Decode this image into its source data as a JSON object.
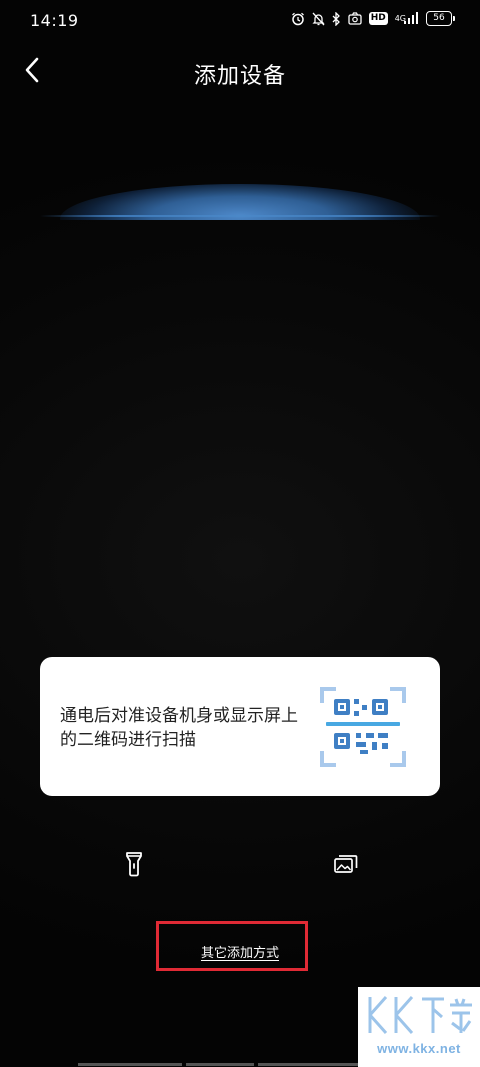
{
  "status_bar": {
    "time": "14:19",
    "network_label": "4G",
    "battery": "56"
  },
  "header": {
    "title": "添加设备"
  },
  "tip_card": {
    "text": "通电后对准设备机身或显示屏上的二维码进行扫描"
  },
  "tools": {
    "flashlight_icon": "flashlight-icon",
    "album_icon": "album-icon"
  },
  "other_methods": {
    "label": "其它添加方式"
  },
  "watermark": {
    "site": "www.kkx.net"
  },
  "colors": {
    "background": "#050505",
    "accent_blue": "#3f7fc4",
    "highlight_red": "#e02a35",
    "card": "#ffffff"
  }
}
